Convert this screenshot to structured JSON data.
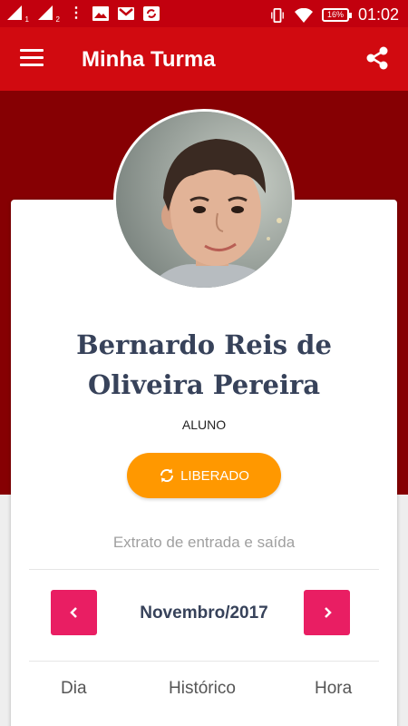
{
  "status_bar": {
    "sim1_index": "1",
    "sim2_index": "2",
    "battery": "16%",
    "time": "01:02"
  },
  "app_bar": {
    "title": "Minha Turma"
  },
  "profile": {
    "name": "Bernardo Reis de Oliveira Pereira",
    "role": "ALUNO",
    "status_label": "LIBERADO"
  },
  "statement": {
    "title": "Extrato de entrada e saída",
    "month": "Novembro/2017",
    "columns": [
      "Dia",
      "Histórico",
      "Hora"
    ]
  },
  "colors": {
    "primary": "#d10a10",
    "primary_dark": "#860003",
    "status_orange": "#ff9800",
    "nav_pink": "#e91e63",
    "name_text": "#37425a"
  }
}
